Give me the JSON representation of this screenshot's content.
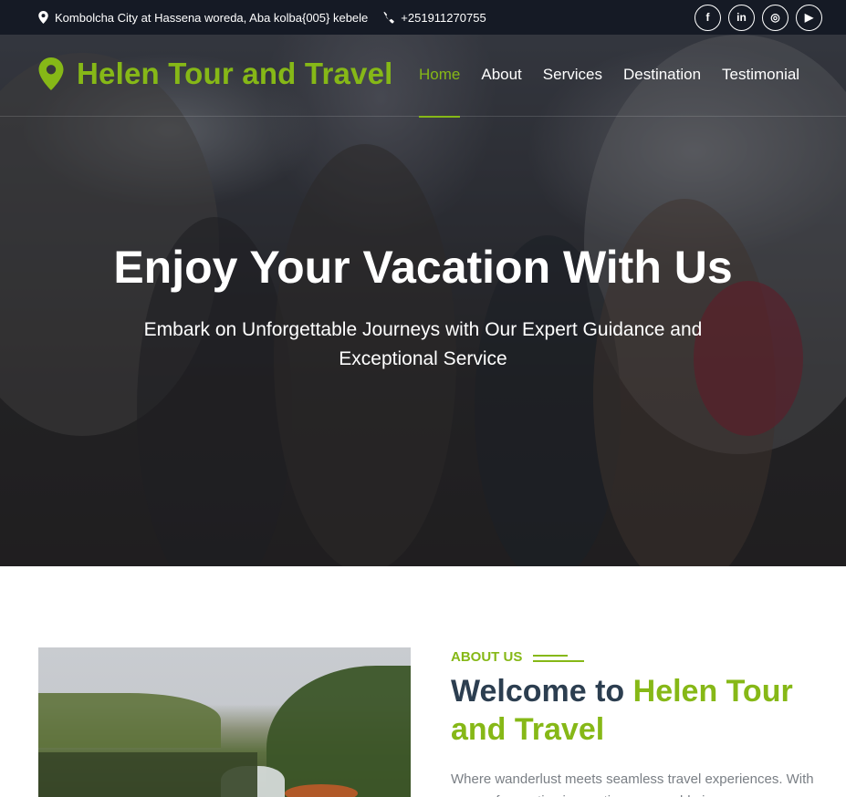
{
  "topbar": {
    "address_icon": "map-marker-icon",
    "address": "Kombolcha City at Hassena woreda, Aba kolba{005} kebele",
    "phone_icon": "phone-icon",
    "phone": "+251911270755",
    "socials": [
      {
        "name": "facebook-icon",
        "glyph": "f"
      },
      {
        "name": "linkedin-icon",
        "glyph": "in"
      },
      {
        "name": "instagram-icon",
        "glyph": "◎"
      },
      {
        "name": "youtube-icon",
        "glyph": "▶"
      }
    ]
  },
  "nav": {
    "brand_icon": "map-marker-icon",
    "brand": "Helen Tour and Travel",
    "items": [
      {
        "label": "Home",
        "active": true
      },
      {
        "label": "About",
        "active": false
      },
      {
        "label": "Services",
        "active": false
      },
      {
        "label": "Destination",
        "active": false
      },
      {
        "label": "Testimonial",
        "active": false
      }
    ]
  },
  "hero": {
    "title": "Enjoy Your Vacation With Us",
    "subtitle": "Embark on Unforgettable Journeys with Our Expert Guidance and Exceptional Service"
  },
  "about": {
    "label": "ABOUT US",
    "title_prefix": "Welcome to ",
    "title_accent": "Helen Tour and Travel",
    "body": "Where wanderlust meets seamless travel experiences. With years of expertise in curating memorable journeys, we guide"
  },
  "colors": {
    "accent": "#86b817",
    "topbar_bg": "#151a25",
    "heading": "#2c3e50",
    "body_text": "#7a7f85"
  }
}
